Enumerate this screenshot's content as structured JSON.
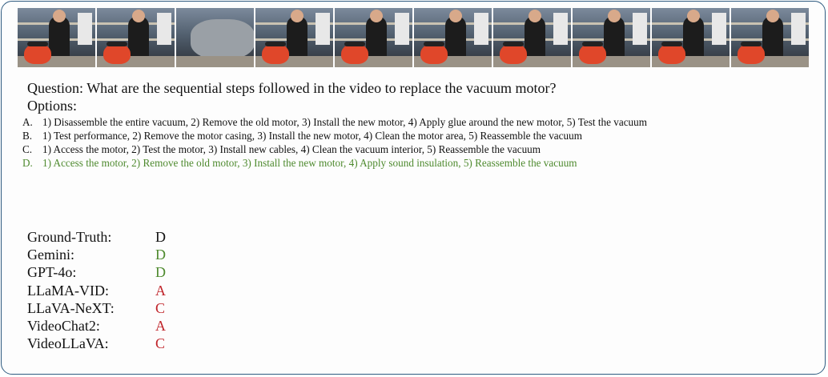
{
  "question": {
    "prefix": "Question:",
    "text": "What are the sequential steps followed in the video to replace the vacuum motor?"
  },
  "options_label": "Options:",
  "options": [
    {
      "letter": "A.",
      "text": "1) Disassemble the entire vacuum, 2) Remove the old motor, 3) Install the new motor, 4) Apply glue around the new motor, 5) Test the vacuum",
      "correct": false
    },
    {
      "letter": "B.",
      "text": "1) Test performance, 2) Remove the motor casing, 3) Install the new motor, 4) Clean the motor area, 5) Reassemble the vacuum",
      "correct": false
    },
    {
      "letter": "C.",
      "text": "1) Access the motor, 2) Test the motor, 3) Install new cables, 4) Clean the vacuum interior, 5) Reassemble the vacuum",
      "correct": false
    },
    {
      "letter": "D.",
      "text": "1) Access the motor, 2) Remove the old motor, 3) Install the new motor, 4) Apply sound insulation, 5) Reassemble the vacuum",
      "correct": true
    }
  ],
  "results": [
    {
      "model": "Ground-Truth:",
      "answer": "D",
      "status": "gt"
    },
    {
      "model": "Gemini:",
      "answer": "D",
      "status": "ok"
    },
    {
      "model": "GPT-4o:",
      "answer": "D",
      "status": "ok"
    },
    {
      "model": "LLaMA-VID:",
      "answer": "A",
      "status": "bad"
    },
    {
      "model": "LLaVA-NeXT:",
      "answer": "C",
      "status": "bad"
    },
    {
      "model": "VideoChat2:",
      "answer": "A",
      "status": "bad"
    },
    {
      "model": "VideoLLaVA:",
      "answer": "C",
      "status": "bad"
    }
  ],
  "colors": {
    "correct": "#4e8a2e",
    "wrong": "#c0242a",
    "border": "#2f5b80"
  },
  "filmstrip": {
    "frame_count": 10,
    "closeup_frames": [
      2
    ]
  }
}
